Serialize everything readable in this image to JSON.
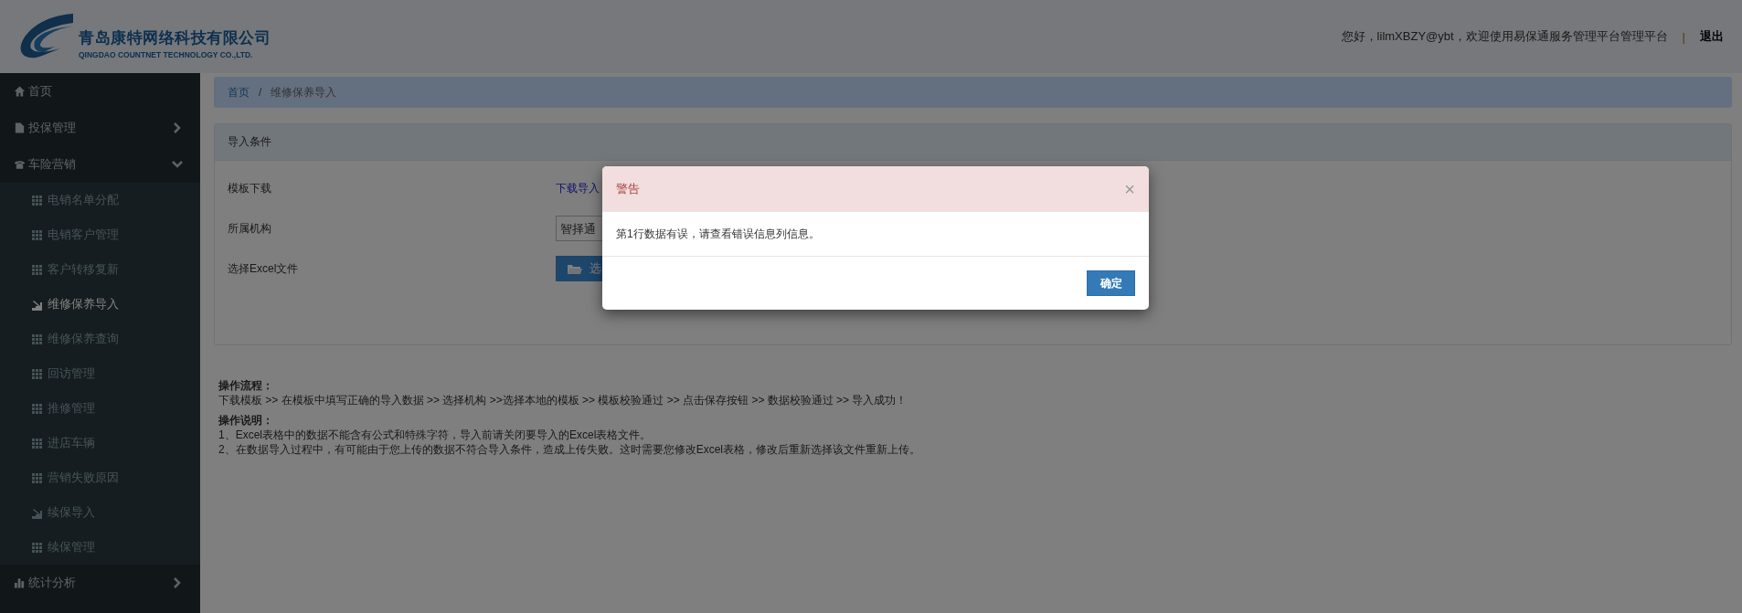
{
  "header": {
    "company_name": "青岛康特网络科技有限公司",
    "company_name_en": "QINGDAO COUNTNET TECHNOLOGY CO.,LTD.",
    "greeting": "您好，lilmXBZY@ybt，欢迎使用易保通服务管理平台管理平台",
    "separator": "|",
    "logout": "退出"
  },
  "sidebar": {
    "items": [
      {
        "label": "首页",
        "kind": "home"
      },
      {
        "label": "投保管理",
        "kind": "policy",
        "expanded": false
      },
      {
        "label": "车险营销",
        "kind": "marketing",
        "expanded": true,
        "children": [
          {
            "label": "电销名单分配",
            "kind": "list",
            "selected": false
          },
          {
            "label": "电销客户管理",
            "kind": "list",
            "selected": false
          },
          {
            "label": "客户转移复新",
            "kind": "list",
            "selected": false
          },
          {
            "label": "维修保养导入",
            "kind": "import",
            "selected": true
          },
          {
            "label": "维修保养查询",
            "kind": "list",
            "selected": false
          },
          {
            "label": "回访管理",
            "kind": "list",
            "selected": false
          },
          {
            "label": "推修管理",
            "kind": "list",
            "selected": false
          },
          {
            "label": "进店车辆",
            "kind": "list",
            "selected": false
          },
          {
            "label": "营销失败原因",
            "kind": "list",
            "selected": false
          },
          {
            "label": "续保导入",
            "kind": "import",
            "selected": false
          },
          {
            "label": "续保管理",
            "kind": "list",
            "selected": false
          }
        ]
      },
      {
        "label": "统计分析",
        "kind": "stats",
        "expanded": false
      }
    ]
  },
  "breadcrumb": {
    "separator": "/",
    "items": [
      {
        "label": "首页",
        "kind": "link"
      },
      {
        "label": "维修保养导入",
        "kind": "current"
      }
    ]
  },
  "panel": {
    "title": "导入条件",
    "rows": [
      {
        "label": "模板下载",
        "kind": "link",
        "value": "下载导入"
      },
      {
        "label": "所属机构",
        "kind": "select",
        "value": "智择通"
      },
      {
        "label": "选择Excel文件",
        "kind": "button",
        "value": "选"
      }
    ]
  },
  "notes": [
    {
      "title": "操作流程：",
      "lines": [
        "下载模板 >> 在模板中填写正确的导入数据 >> 选择机构 >>选择本地的模板 >> 模板校验通过 >> 点击保存按钮 >> 数据校验通过 >> 导入成功！"
      ]
    },
    {
      "title": "操作说明：",
      "lines": [
        "1、Excel表格中的数据不能含有公式和特殊字符，导入前请关闭要导入的Excel表格文件。",
        "2、在数据导入过程中，有可能由于您上传的数据不符合导入条件，造成上传失败。这时需要您修改Excel表格，修改后重新选择该文件重新上传。"
      ]
    }
  ],
  "modal": {
    "title": "警告",
    "close": "×",
    "message": "第1行数据有误，请查看错误信息列信息。",
    "ok_button": "确定"
  }
}
